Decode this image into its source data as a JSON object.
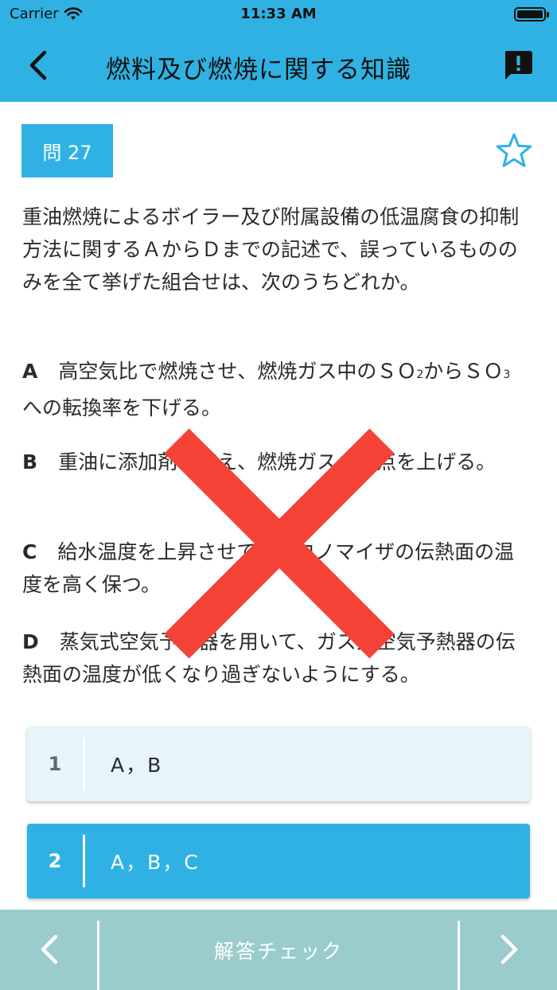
{
  "status_bar": {
    "carrier": "Carrier",
    "time": "11:33 AM"
  },
  "nav": {
    "title": "燃料及び燃焼に関する知識"
  },
  "question": {
    "badge": "問 27",
    "text": "重油燃焼によるボイラー及び附属設備の低温腐食の抑制方法に関するＡからＤまでの記述で、誤っているもののみを全て挙げた組合せは、次のうちどれか。",
    "statements": [
      {
        "letter": "A",
        "text_before": "高空気比で燃焼させ、燃焼ガス中のＳＯ",
        "sub1": "2",
        "text_mid": "からＳＯ",
        "sub2": "3",
        "text_after": "への転換率を下げる。"
      },
      {
        "letter": "B",
        "text": "重油に添加剤を加え、燃焼ガスの露点を上げる。"
      },
      {
        "letter": "C",
        "text": "給水温度を上昇させて、エコノマイザの伝熱面の温度を高く保つ。"
      },
      {
        "letter": "D",
        "text": "蒸気式空気予熱器を用いて、ガス式空気予熱器の伝熱面の温度が低くなり過ぎないようにする。"
      }
    ]
  },
  "choices": [
    {
      "number": "1",
      "label": "A，B"
    },
    {
      "number": "2",
      "label": "A，B，C"
    }
  ],
  "footer": {
    "check_label": "解答チェック"
  },
  "colors": {
    "accent": "#2fb2e3",
    "footer": "#9acccc",
    "wrong_mark": "#f44336",
    "choice_idle": "#e6f4fb"
  },
  "icons": {
    "back": "chevron-left-icon",
    "report": "report-bubble-icon",
    "favorite": "star-outline-icon",
    "prev": "chevron-left-icon",
    "next": "chevron-right-icon",
    "result": "wrong-cross-icon"
  }
}
